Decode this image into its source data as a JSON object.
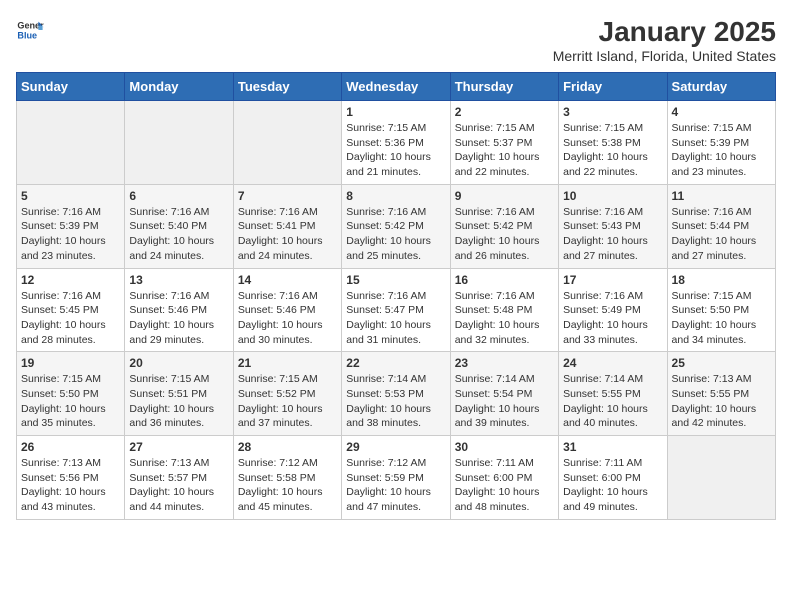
{
  "header": {
    "logo_general": "General",
    "logo_blue": "Blue",
    "title": "January 2025",
    "subtitle": "Merritt Island, Florida, United States"
  },
  "days_of_week": [
    "Sunday",
    "Monday",
    "Tuesday",
    "Wednesday",
    "Thursday",
    "Friday",
    "Saturday"
  ],
  "weeks": [
    [
      {
        "day": "",
        "info": ""
      },
      {
        "day": "",
        "info": ""
      },
      {
        "day": "",
        "info": ""
      },
      {
        "day": "1",
        "info": "Sunrise: 7:15 AM\nSunset: 5:36 PM\nDaylight: 10 hours\nand 21 minutes."
      },
      {
        "day": "2",
        "info": "Sunrise: 7:15 AM\nSunset: 5:37 PM\nDaylight: 10 hours\nand 22 minutes."
      },
      {
        "day": "3",
        "info": "Sunrise: 7:15 AM\nSunset: 5:38 PM\nDaylight: 10 hours\nand 22 minutes."
      },
      {
        "day": "4",
        "info": "Sunrise: 7:15 AM\nSunset: 5:39 PM\nDaylight: 10 hours\nand 23 minutes."
      }
    ],
    [
      {
        "day": "5",
        "info": "Sunrise: 7:16 AM\nSunset: 5:39 PM\nDaylight: 10 hours\nand 23 minutes."
      },
      {
        "day": "6",
        "info": "Sunrise: 7:16 AM\nSunset: 5:40 PM\nDaylight: 10 hours\nand 24 minutes."
      },
      {
        "day": "7",
        "info": "Sunrise: 7:16 AM\nSunset: 5:41 PM\nDaylight: 10 hours\nand 24 minutes."
      },
      {
        "day": "8",
        "info": "Sunrise: 7:16 AM\nSunset: 5:42 PM\nDaylight: 10 hours\nand 25 minutes."
      },
      {
        "day": "9",
        "info": "Sunrise: 7:16 AM\nSunset: 5:42 PM\nDaylight: 10 hours\nand 26 minutes."
      },
      {
        "day": "10",
        "info": "Sunrise: 7:16 AM\nSunset: 5:43 PM\nDaylight: 10 hours\nand 27 minutes."
      },
      {
        "day": "11",
        "info": "Sunrise: 7:16 AM\nSunset: 5:44 PM\nDaylight: 10 hours\nand 27 minutes."
      }
    ],
    [
      {
        "day": "12",
        "info": "Sunrise: 7:16 AM\nSunset: 5:45 PM\nDaylight: 10 hours\nand 28 minutes."
      },
      {
        "day": "13",
        "info": "Sunrise: 7:16 AM\nSunset: 5:46 PM\nDaylight: 10 hours\nand 29 minutes."
      },
      {
        "day": "14",
        "info": "Sunrise: 7:16 AM\nSunset: 5:46 PM\nDaylight: 10 hours\nand 30 minutes."
      },
      {
        "day": "15",
        "info": "Sunrise: 7:16 AM\nSunset: 5:47 PM\nDaylight: 10 hours\nand 31 minutes."
      },
      {
        "day": "16",
        "info": "Sunrise: 7:16 AM\nSunset: 5:48 PM\nDaylight: 10 hours\nand 32 minutes."
      },
      {
        "day": "17",
        "info": "Sunrise: 7:16 AM\nSunset: 5:49 PM\nDaylight: 10 hours\nand 33 minutes."
      },
      {
        "day": "18",
        "info": "Sunrise: 7:15 AM\nSunset: 5:50 PM\nDaylight: 10 hours\nand 34 minutes."
      }
    ],
    [
      {
        "day": "19",
        "info": "Sunrise: 7:15 AM\nSunset: 5:50 PM\nDaylight: 10 hours\nand 35 minutes."
      },
      {
        "day": "20",
        "info": "Sunrise: 7:15 AM\nSunset: 5:51 PM\nDaylight: 10 hours\nand 36 minutes."
      },
      {
        "day": "21",
        "info": "Sunrise: 7:15 AM\nSunset: 5:52 PM\nDaylight: 10 hours\nand 37 minutes."
      },
      {
        "day": "22",
        "info": "Sunrise: 7:14 AM\nSunset: 5:53 PM\nDaylight: 10 hours\nand 38 minutes."
      },
      {
        "day": "23",
        "info": "Sunrise: 7:14 AM\nSunset: 5:54 PM\nDaylight: 10 hours\nand 39 minutes."
      },
      {
        "day": "24",
        "info": "Sunrise: 7:14 AM\nSunset: 5:55 PM\nDaylight: 10 hours\nand 40 minutes."
      },
      {
        "day": "25",
        "info": "Sunrise: 7:13 AM\nSunset: 5:55 PM\nDaylight: 10 hours\nand 42 minutes."
      }
    ],
    [
      {
        "day": "26",
        "info": "Sunrise: 7:13 AM\nSunset: 5:56 PM\nDaylight: 10 hours\nand 43 minutes."
      },
      {
        "day": "27",
        "info": "Sunrise: 7:13 AM\nSunset: 5:57 PM\nDaylight: 10 hours\nand 44 minutes."
      },
      {
        "day": "28",
        "info": "Sunrise: 7:12 AM\nSunset: 5:58 PM\nDaylight: 10 hours\nand 45 minutes."
      },
      {
        "day": "29",
        "info": "Sunrise: 7:12 AM\nSunset: 5:59 PM\nDaylight: 10 hours\nand 47 minutes."
      },
      {
        "day": "30",
        "info": "Sunrise: 7:11 AM\nSunset: 6:00 PM\nDaylight: 10 hours\nand 48 minutes."
      },
      {
        "day": "31",
        "info": "Sunrise: 7:11 AM\nSunset: 6:00 PM\nDaylight: 10 hours\nand 49 minutes."
      },
      {
        "day": "",
        "info": ""
      }
    ]
  ]
}
